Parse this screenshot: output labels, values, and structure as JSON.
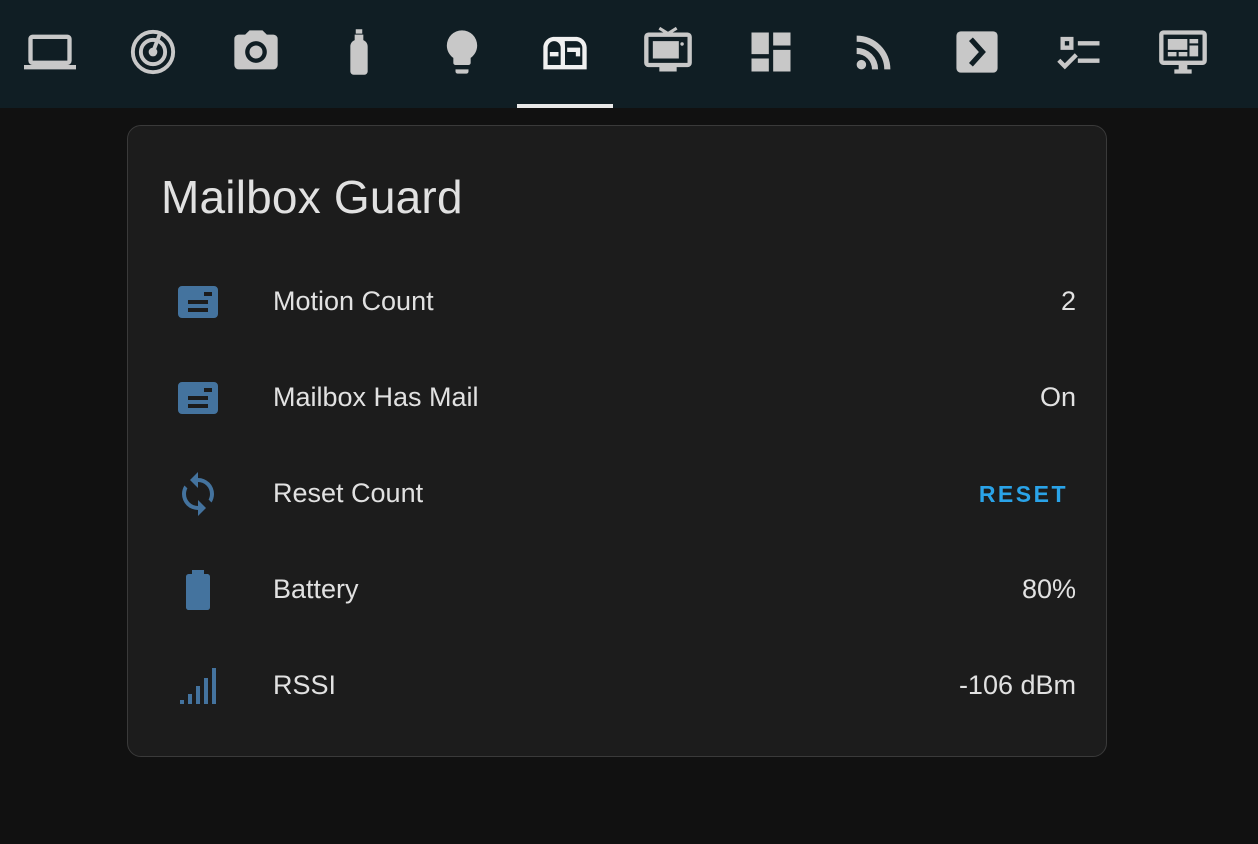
{
  "colors": {
    "topbar": "#101e24",
    "icon_inactive": "#c8c8c8",
    "icon_active": "#f0f0f0",
    "entity_icon": "#44739e",
    "accent": "#2aa3e8"
  },
  "nav": {
    "tabs": [
      {
        "icon": "laptop-icon",
        "active": false
      },
      {
        "icon": "radar-icon",
        "active": false
      },
      {
        "icon": "camera-icon",
        "active": false
      },
      {
        "icon": "gas-cylinder-icon",
        "active": false
      },
      {
        "icon": "lightbulb-icon",
        "active": false
      },
      {
        "icon": "mailbox-icon",
        "active": true
      },
      {
        "icon": "television-icon",
        "active": false
      },
      {
        "icon": "view-dashboard-icon",
        "active": false
      },
      {
        "icon": "rss-icon",
        "active": false
      },
      {
        "icon": "chevron-box-icon",
        "active": false
      },
      {
        "icon": "format-list-checks-icon",
        "active": false
      },
      {
        "icon": "monitor-dashboard-icon",
        "active": false
      }
    ]
  },
  "card": {
    "title": "Mailbox Guard",
    "rows": [
      {
        "icon": "mailbox-icon",
        "label": "Motion Count",
        "value": "2"
      },
      {
        "icon": "mailbox-icon",
        "label": "Mailbox Has Mail",
        "value": "On"
      },
      {
        "icon": "sync-icon",
        "label": "Reset Count",
        "action": "RESET"
      },
      {
        "icon": "battery-icon",
        "label": "Battery",
        "value": "80%"
      },
      {
        "icon": "signal-icon",
        "label": "RSSI",
        "value": "-106 dBm"
      }
    ]
  }
}
